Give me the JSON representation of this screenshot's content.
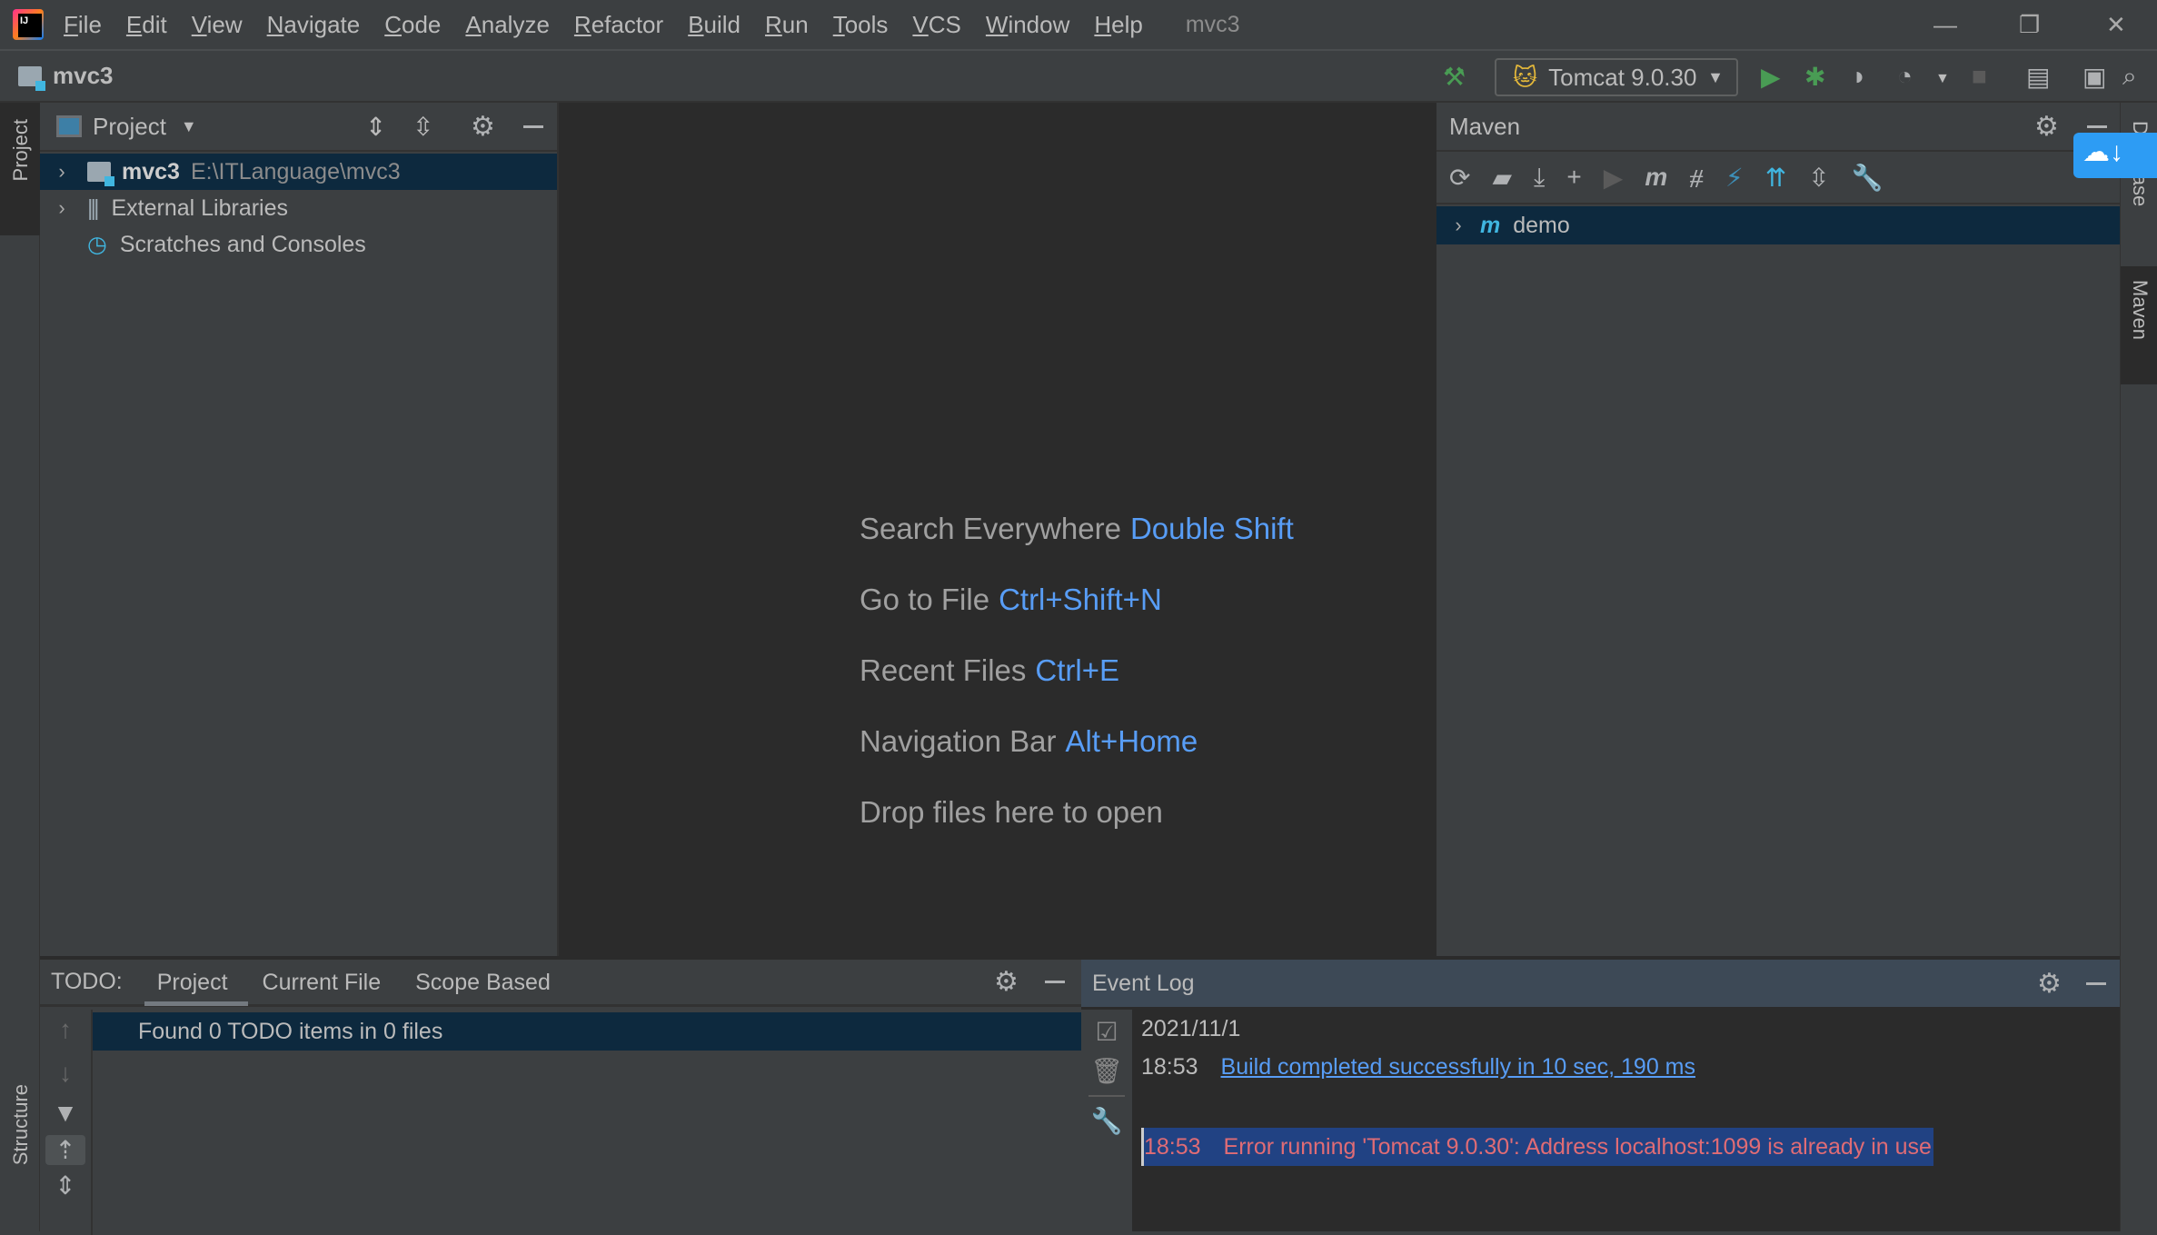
{
  "menu": {
    "items": [
      "File",
      "Edit",
      "View",
      "Navigate",
      "Code",
      "Analyze",
      "Refactor",
      "Build",
      "Run",
      "Tools",
      "VCS",
      "Window",
      "Help"
    ],
    "window_title": "mvc3"
  },
  "navbar": {
    "project": "mvc3",
    "run_config": "Tomcat 9.0.30"
  },
  "left_strip": {
    "project_tab": "Project",
    "structure_tab": "Structure"
  },
  "project_panel": {
    "title": "Project",
    "tree": [
      {
        "name": "mvc3",
        "path": "E:\\ITLanguage\\mvc3"
      },
      {
        "name": "External Libraries"
      },
      {
        "name": "Scratches and Consoles"
      }
    ]
  },
  "editor": {
    "hints": [
      {
        "label": "Search Everywhere",
        "key": "Double Shift"
      },
      {
        "label": "Go to File",
        "key": "Ctrl+Shift+N"
      },
      {
        "label": "Recent Files",
        "key": "Ctrl+E"
      },
      {
        "label": "Navigation Bar",
        "key": "Alt+Home"
      },
      {
        "label": "Drop files here to open",
        "key": ""
      }
    ]
  },
  "maven": {
    "title": "Maven",
    "items": [
      "demo"
    ]
  },
  "right_strip": {
    "database_tab": "Database",
    "maven_tab": "Maven"
  },
  "todo": {
    "label": "TODO:",
    "tabs": [
      "Project",
      "Current File",
      "Scope Based"
    ],
    "active_tab": "Project",
    "message": "Found 0 TODO items in 0 files"
  },
  "event_log": {
    "title": "Event Log",
    "date": "2021/11/1",
    "entries": [
      {
        "time": "18:53",
        "text": "Build completed successfully in 10 sec, 190 ms",
        "type": "link"
      },
      {
        "time": "18:53",
        "text": "Error running 'Tomcat 9.0.30': Address localhost:1099 is already in use",
        "type": "error"
      }
    ]
  },
  "colors": {
    "accent": "#589df6",
    "error": "#e06c75",
    "selection": "#0d293e",
    "run_green": "#499c54"
  }
}
